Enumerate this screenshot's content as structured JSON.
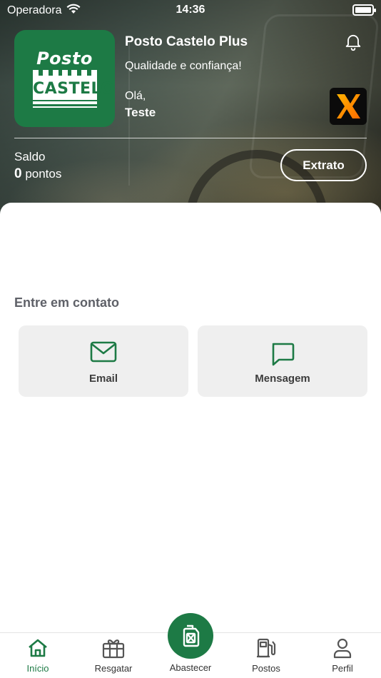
{
  "status_bar": {
    "carrier": "Operadora",
    "time": "14:36"
  },
  "header": {
    "logo": {
      "top_text": "Posto",
      "bottom_text": "CASTELO"
    },
    "store_name": "Posto Castelo Plus",
    "tagline": "Qualidade e confiança!",
    "greeting": "Olá,",
    "username": "Teste",
    "icons": {
      "notifications": "bell-icon",
      "partner": "partner-x-logo"
    }
  },
  "balance": {
    "label": "Saldo",
    "points_value": "0",
    "points_unit": "pontos",
    "statement_button": "Extrato"
  },
  "contact": {
    "title": "Entre em contato",
    "options": [
      {
        "label": "Email",
        "icon": "envelope-icon"
      },
      {
        "label": "Mensagem",
        "icon": "chat-bubble-icon"
      }
    ]
  },
  "tabbar": {
    "items": [
      {
        "label": "Início",
        "icon": "home-icon",
        "active": true
      },
      {
        "label": "Resgatar",
        "icon": "gift-icon",
        "active": false
      },
      {
        "label": "Abastecer",
        "icon": "fuel-can-icon",
        "active": false
      },
      {
        "label": "Postos",
        "icon": "fuel-pump-icon",
        "active": false
      },
      {
        "label": "Perfil",
        "icon": "user-icon",
        "active": false
      }
    ]
  },
  "colors": {
    "brand_green": "#1d7a45",
    "card_bg": "#efefef",
    "muted_text": "#5f6168"
  }
}
